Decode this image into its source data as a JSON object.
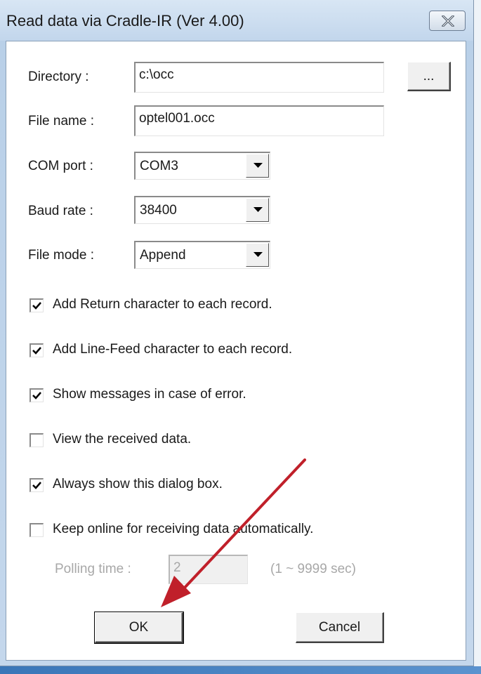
{
  "window": {
    "title": "Read data via Cradle-IR (Ver 4.00)",
    "close_icon": "close-icon"
  },
  "form": {
    "directory_label": "Directory :",
    "directory_value": "c:\\occ",
    "browse_label": "...",
    "filename_label": "File name :",
    "filename_value": "optel001.occ",
    "comport_label": "COM port :",
    "comport_value": "COM3",
    "baud_label": "Baud rate :",
    "baud_value": "38400",
    "filemode_label": "File mode :",
    "filemode_value": "Append"
  },
  "options": [
    {
      "label": "Add Return character to each record.",
      "checked": true
    },
    {
      "label": "Add Line-Feed character to each record.",
      "checked": true
    },
    {
      "label": "Show messages in case of error.",
      "checked": true
    },
    {
      "label": "View the received data.",
      "checked": false
    },
    {
      "label": "Always show this dialog box.",
      "checked": true
    },
    {
      "label": "Keep online for receiving data automatically.",
      "checked": false
    }
  ],
  "polling": {
    "label": "Polling time :",
    "value": "2",
    "range": "(1 ~ 9999 sec)"
  },
  "buttons": {
    "ok": "OK",
    "cancel": "Cancel"
  },
  "annotation": {
    "arrow_color": "#c0202a"
  }
}
